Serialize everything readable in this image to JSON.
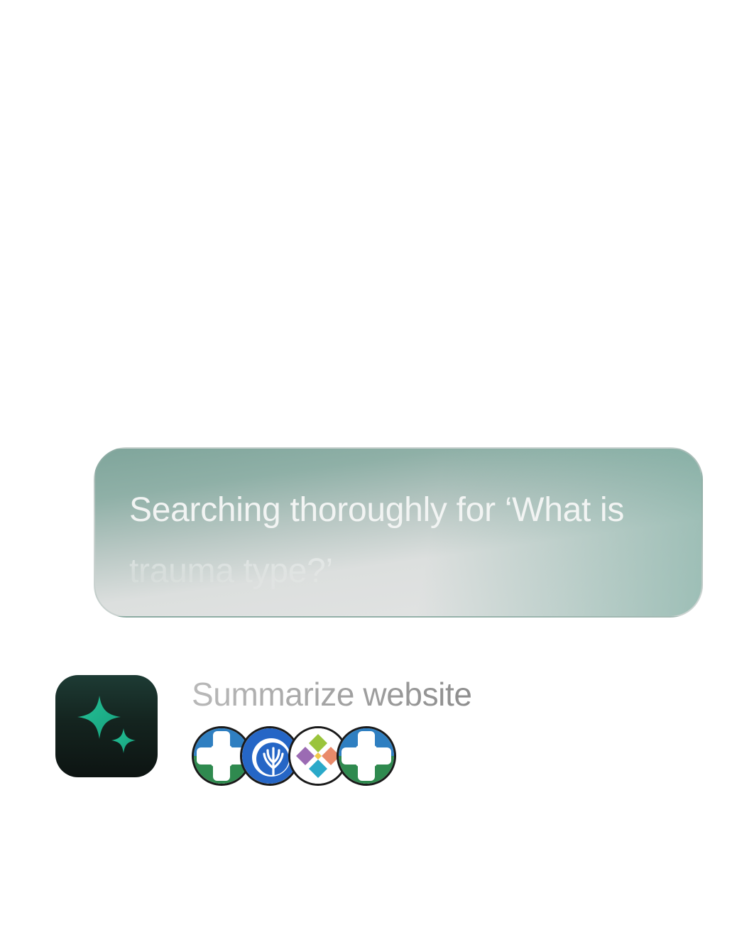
{
  "search": {
    "text": "Searching thoroughly for ‘What is trauma type?’"
  },
  "app": {
    "icon": "sparkle-icon",
    "accent_color": "#1fae8a"
  },
  "action": {
    "label": "Summarize website"
  },
  "sources": [
    {
      "icon": "cleveland-clinic-icon"
    },
    {
      "icon": "tree-logo-icon"
    },
    {
      "icon": "colorful-diamond-logo-icon"
    },
    {
      "icon": "cleveland-clinic-icon"
    }
  ]
}
